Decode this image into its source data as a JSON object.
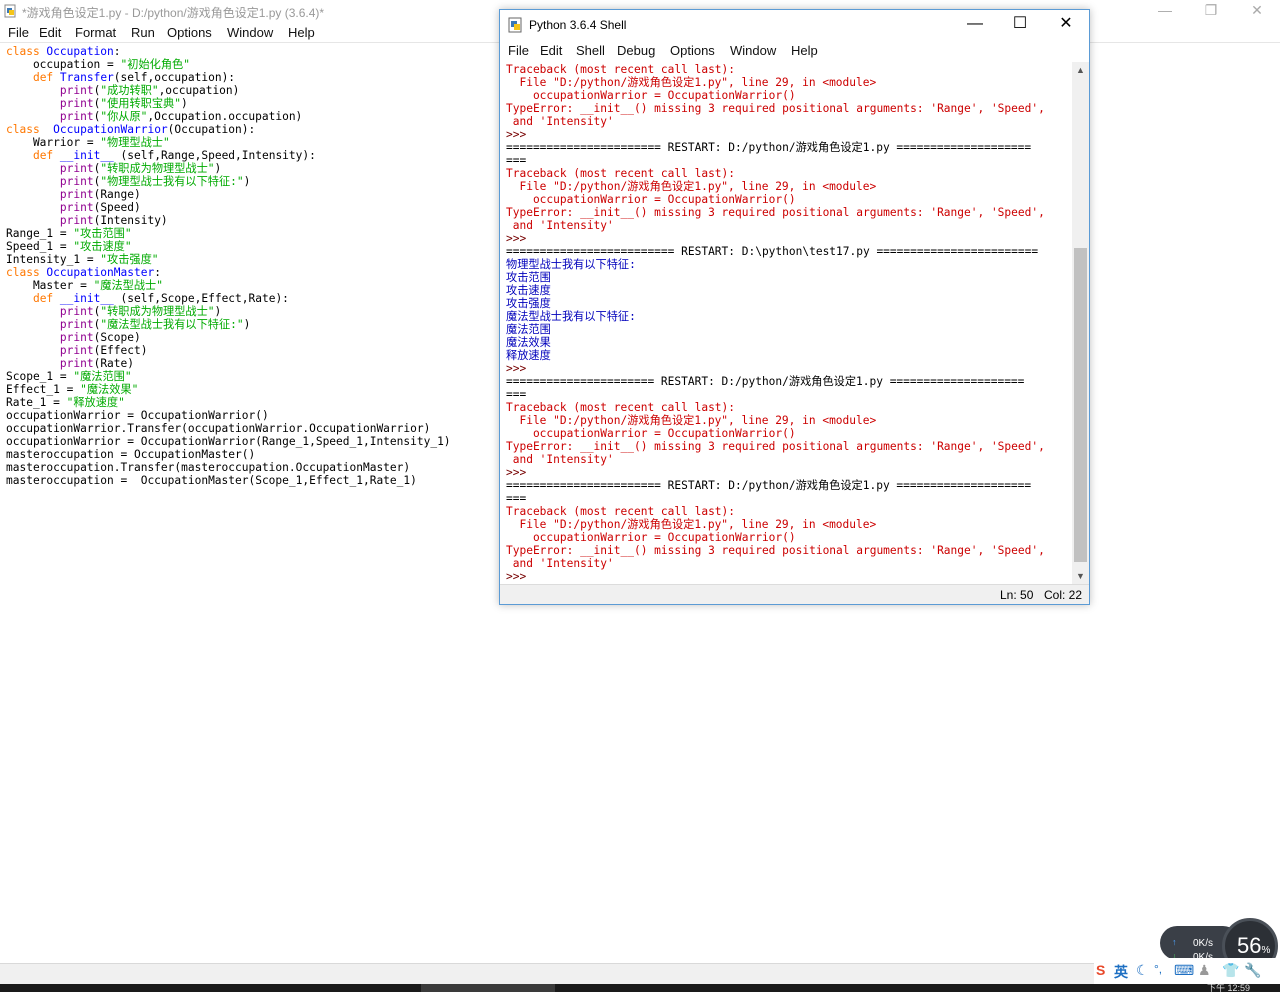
{
  "editor": {
    "title": "*游戏角色设定1.py - D:/python/游戏角色设定1.py (3.6.4)*",
    "menu": [
      "File",
      "Edit",
      "Format",
      "Run",
      "Options",
      "Window",
      "Help"
    ],
    "code_lines": [
      [
        {
          "t": "class ",
          "c": "kw"
        },
        {
          "t": "Occupation",
          "c": "def"
        },
        {
          "t": ":",
          "c": ""
        }
      ],
      [
        {
          "t": "    occupation = ",
          "c": ""
        },
        {
          "t": "\"初始化角色\"",
          "c": "str"
        }
      ],
      [
        {
          "t": "    ",
          "c": ""
        },
        {
          "t": "def ",
          "c": "kw"
        },
        {
          "t": "Transfer",
          "c": "def"
        },
        {
          "t": "(self,occupation):",
          "c": ""
        }
      ],
      [
        {
          "t": "        ",
          "c": ""
        },
        {
          "t": "print",
          "c": "bi"
        },
        {
          "t": "(",
          "c": ""
        },
        {
          "t": "\"成功转职\"",
          "c": "str"
        },
        {
          "t": ",occupation)",
          "c": ""
        }
      ],
      [
        {
          "t": "        ",
          "c": ""
        },
        {
          "t": "print",
          "c": "bi"
        },
        {
          "t": "(",
          "c": ""
        },
        {
          "t": "\"使用转职宝典\"",
          "c": "str"
        },
        {
          "t": ")",
          "c": ""
        }
      ],
      [
        {
          "t": "        ",
          "c": ""
        },
        {
          "t": "print",
          "c": "bi"
        },
        {
          "t": "(",
          "c": ""
        },
        {
          "t": "\"你从原\"",
          "c": "str"
        },
        {
          "t": ",Occupation.occupation)",
          "c": ""
        }
      ],
      [
        {
          "t": "class  ",
          "c": "kw"
        },
        {
          "t": "OccupationWarrior",
          "c": "def"
        },
        {
          "t": "(Occupation):",
          "c": ""
        }
      ],
      [
        {
          "t": "    Warrior = ",
          "c": ""
        },
        {
          "t": "\"物理型战士\"",
          "c": "str"
        }
      ],
      [
        {
          "t": "    ",
          "c": ""
        },
        {
          "t": "def ",
          "c": "kw"
        },
        {
          "t": "__init__",
          "c": "def"
        },
        {
          "t": " (self,Range,Speed,Intensity):",
          "c": ""
        }
      ],
      [
        {
          "t": "        ",
          "c": ""
        },
        {
          "t": "print",
          "c": "bi"
        },
        {
          "t": "(",
          "c": ""
        },
        {
          "t": "\"转职成为物理型战士\"",
          "c": "str"
        },
        {
          "t": ")",
          "c": ""
        }
      ],
      [
        {
          "t": "        ",
          "c": ""
        },
        {
          "t": "print",
          "c": "bi"
        },
        {
          "t": "(",
          "c": ""
        },
        {
          "t": "\"物理型战士我有以下特征:\"",
          "c": "str"
        },
        {
          "t": ")",
          "c": ""
        }
      ],
      [
        {
          "t": "        ",
          "c": ""
        },
        {
          "t": "print",
          "c": "bi"
        },
        {
          "t": "(Range)",
          "c": ""
        }
      ],
      [
        {
          "t": "        ",
          "c": ""
        },
        {
          "t": "print",
          "c": "bi"
        },
        {
          "t": "(Speed)",
          "c": ""
        }
      ],
      [
        {
          "t": "        ",
          "c": ""
        },
        {
          "t": "print",
          "c": "bi"
        },
        {
          "t": "(Intensity)",
          "c": ""
        }
      ],
      [
        {
          "t": "Range_1 = ",
          "c": ""
        },
        {
          "t": "\"攻击范围\"",
          "c": "str"
        }
      ],
      [
        {
          "t": "Speed_1 = ",
          "c": ""
        },
        {
          "t": "\"攻击速度\"",
          "c": "str"
        }
      ],
      [
        {
          "t": "Intensity_1 = ",
          "c": ""
        },
        {
          "t": "\"攻击强度\"",
          "c": "str"
        }
      ],
      [
        {
          "t": "class ",
          "c": "kw"
        },
        {
          "t": "OccupationMaster",
          "c": "def"
        },
        {
          "t": ":",
          "c": ""
        }
      ],
      [
        {
          "t": "    Master = ",
          "c": ""
        },
        {
          "t": "\"魔法型战士\"",
          "c": "str"
        }
      ],
      [
        {
          "t": "    ",
          "c": ""
        },
        {
          "t": "def ",
          "c": "kw"
        },
        {
          "t": "__init__",
          "c": "def"
        },
        {
          "t": " (self,Scope,Effect,Rate):",
          "c": ""
        }
      ],
      [
        {
          "t": "        ",
          "c": ""
        },
        {
          "t": "print",
          "c": "bi"
        },
        {
          "t": "(",
          "c": ""
        },
        {
          "t": "\"转职成为物理型战士\"",
          "c": "str"
        },
        {
          "t": ")",
          "c": ""
        }
      ],
      [
        {
          "t": "        ",
          "c": ""
        },
        {
          "t": "print",
          "c": "bi"
        },
        {
          "t": "(",
          "c": ""
        },
        {
          "t": "\"魔法型战士我有以下特征:\"",
          "c": "str"
        },
        {
          "t": ")",
          "c": ""
        }
      ],
      [
        {
          "t": "        ",
          "c": ""
        },
        {
          "t": "print",
          "c": "bi"
        },
        {
          "t": "(Scope)",
          "c": ""
        }
      ],
      [
        {
          "t": "        ",
          "c": ""
        },
        {
          "t": "print",
          "c": "bi"
        },
        {
          "t": "(Effect)",
          "c": ""
        }
      ],
      [
        {
          "t": "        ",
          "c": ""
        },
        {
          "t": "print",
          "c": "bi"
        },
        {
          "t": "(Rate)",
          "c": ""
        }
      ],
      [
        {
          "t": "Scope_1 = ",
          "c": ""
        },
        {
          "t": "\"魔法范围\"",
          "c": "str"
        }
      ],
      [
        {
          "t": "Effect_1 = ",
          "c": ""
        },
        {
          "t": "\"魔法效果\"",
          "c": "str"
        }
      ],
      [
        {
          "t": "Rate_1 = ",
          "c": ""
        },
        {
          "t": "\"释放速度\"",
          "c": "str"
        }
      ],
      [
        {
          "t": "occupationWarrior = OccupationWarrior()",
          "c": ""
        }
      ],
      [
        {
          "t": "occupationWarrior.Transfer(occupationWarrior.OccupationWarrior)",
          "c": ""
        }
      ],
      [
        {
          "t": "occupationWarrior = OccupationWarrior(Range_1,Speed_1,Intensity_1)",
          "c": ""
        }
      ],
      [
        {
          "t": "masteroccupation = OccupationMaster()",
          "c": ""
        }
      ],
      [
        {
          "t": "masteroccupation.Transfer(masteroccupation.OccupationMaster)",
          "c": ""
        }
      ],
      [
        {
          "t": "masteroccupation =  OccupationMaster(Scope_1,Effect_1,Rate_1)",
          "c": ""
        }
      ]
    ]
  },
  "shell": {
    "title": "Python 3.6.4 Shell",
    "menu": [
      "File",
      "Edit",
      "Shell",
      "Debug",
      "Options",
      "Window",
      "Help"
    ],
    "lines": [
      {
        "t": "Traceback (most recent call last):",
        "c": "err"
      },
      {
        "t": "  File \"D:/python/游戏角色设定1.py\", line 29, in <module>",
        "c": "err"
      },
      {
        "t": "    occupationWarrior = OccupationWarrior()",
        "c": "err"
      },
      {
        "t": "TypeError: __init__() missing 3 required positional arguments: 'Range', 'Speed',",
        "c": "err"
      },
      {
        "t": " and 'Intensity'",
        "c": "err"
      },
      {
        "t": ">>> ",
        "c": "prm"
      },
      {
        "t": "======================= RESTART: D:/python/游戏角色设定1.py ====================",
        "c": "rst"
      },
      {
        "t": "===",
        "c": "rst"
      },
      {
        "t": "Traceback (most recent call last):",
        "c": "err"
      },
      {
        "t": "  File \"D:/python/游戏角色设定1.py\", line 29, in <module>",
        "c": "err"
      },
      {
        "t": "    occupationWarrior = OccupationWarrior()",
        "c": "err"
      },
      {
        "t": "TypeError: __init__() missing 3 required positional arguments: 'Range', 'Speed',",
        "c": "err"
      },
      {
        "t": " and 'Intensity'",
        "c": "err"
      },
      {
        "t": ">>> ",
        "c": "prm"
      },
      {
        "t": "========================= RESTART: D:\\python\\test17.py ========================",
        "c": "rst"
      },
      {
        "t": "物理型战士我有以下特征:",
        "c": "out"
      },
      {
        "t": "攻击范围",
        "c": "out"
      },
      {
        "t": "攻击速度",
        "c": "out"
      },
      {
        "t": "攻击强度",
        "c": "out"
      },
      {
        "t": "魔法型战士我有以下特征:",
        "c": "out"
      },
      {
        "t": "魔法范围",
        "c": "out"
      },
      {
        "t": "魔法效果",
        "c": "out"
      },
      {
        "t": "释放速度",
        "c": "out"
      },
      {
        "t": ">>> ",
        "c": "prm"
      },
      {
        "t": "====================== RESTART: D:/python/游戏角色设定1.py ====================",
        "c": "rst"
      },
      {
        "t": "===",
        "c": "rst"
      },
      {
        "t": "Traceback (most recent call last):",
        "c": "err"
      },
      {
        "t": "  File \"D:/python/游戏角色设定1.py\", line 29, in <module>",
        "c": "err"
      },
      {
        "t": "    occupationWarrior = OccupationWarrior()",
        "c": "err"
      },
      {
        "t": "TypeError: __init__() missing 3 required positional arguments: 'Range', 'Speed',",
        "c": "err"
      },
      {
        "t": " and 'Intensity'",
        "c": "err"
      },
      {
        "t": ">>> ",
        "c": "prm"
      },
      {
        "t": "======================= RESTART: D:/python/游戏角色设定1.py ====================",
        "c": "rst"
      },
      {
        "t": "===",
        "c": "rst"
      },
      {
        "t": "Traceback (most recent call last):",
        "c": "err"
      },
      {
        "t": "  File \"D:/python/游戏角色设定1.py\", line 29, in <module>",
        "c": "err"
      },
      {
        "t": "    occupationWarrior = OccupationWarrior()",
        "c": "err"
      },
      {
        "t": "TypeError: __init__() missing 3 required positional arguments: 'Range', 'Speed',",
        "c": "err"
      },
      {
        "t": " and 'Intensity'",
        "c": "err"
      },
      {
        "t": ">>> ",
        "c": "prm"
      }
    ],
    "status_ln": "Ln: 50",
    "status_col": "Col: 22",
    "scroll_thumb_fraction": 0.6
  },
  "net_monitor": {
    "upload": "0K/s",
    "download": "0K/s",
    "percent": "56",
    "percent_sign": "%"
  },
  "ime": {
    "lang": "英"
  },
  "taskbar": {
    "clock": "下午 12:59"
  },
  "colors": {
    "keyword": "#ff7700",
    "definition": "#0000ff",
    "string": "#00aa00",
    "builtin": "#900090",
    "error": "#cc0000",
    "output": "#0000bb"
  },
  "icons": [
    "python-file-icon",
    "python-shell-icon",
    "minimize-icon",
    "maximize-icon",
    "close-icon",
    "sogou-ime-icon",
    "moon-icon",
    "keyboard-icon",
    "tshirt-icon",
    "tools-icon"
  ]
}
